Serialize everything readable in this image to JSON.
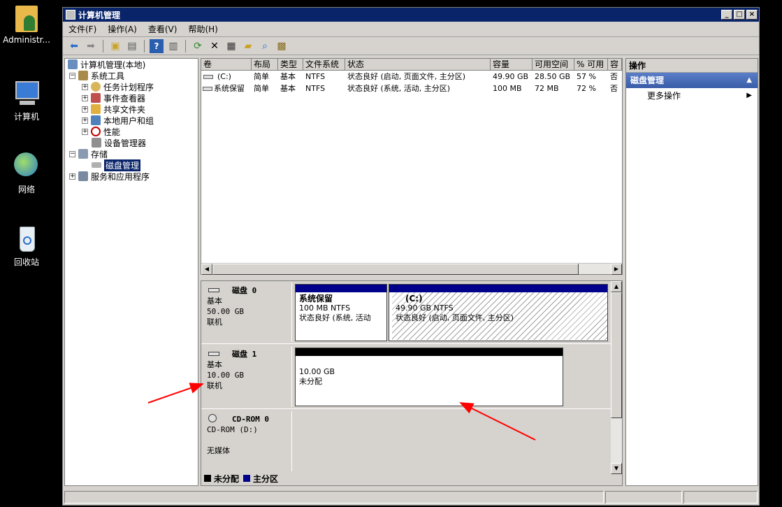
{
  "desktop": {
    "icons": [
      {
        "label": "Administr..."
      },
      {
        "label": "计算机"
      },
      {
        "label": "网络"
      },
      {
        "label": "回收站"
      }
    ]
  },
  "window": {
    "title": "计算机管理",
    "controls": {
      "minimize": "_",
      "maximize": "□",
      "close": "×"
    }
  },
  "menu": [
    "文件(F)",
    "操作(A)",
    "查看(V)",
    "帮助(H)"
  ],
  "tree": {
    "root": "计算机管理(本地)",
    "system_tools": "系统工具",
    "task_scheduler": "任务计划程序",
    "event_viewer": "事件查看器",
    "shared_folders": "共享文件夹",
    "local_users": "本地用户和组",
    "performance": "性能",
    "device_manager": "设备管理器",
    "storage": "存储",
    "disk_management": "磁盘管理",
    "services": "服务和应用程序"
  },
  "volumes": {
    "headers": [
      "卷",
      "布局",
      "类型",
      "文件系统",
      "状态",
      "容量",
      "可用空间",
      "% 可用",
      "容"
    ],
    "rows": [
      [
        "(C:)",
        "简单",
        "基本",
        "NTFS",
        "状态良好 (启动, 页面文件, 主分区)",
        "49.90 GB",
        "28.50 GB",
        "57 %",
        "否"
      ],
      [
        "系统保留",
        "简单",
        "基本",
        "NTFS",
        "状态良好 (系统, 活动, 主分区)",
        "100 MB",
        "72 MB",
        "72 %",
        "否"
      ]
    ]
  },
  "disks": {
    "disk0": {
      "name": "磁盘 0",
      "type": "基本",
      "size": "50.00 GB",
      "status": "联机",
      "p1": {
        "name": "系统保留",
        "size": "100 MB NTFS",
        "status": "状态良好 (系统, 活动"
      },
      "p2": {
        "name": "(C:)",
        "size": "49.90 GB NTFS",
        "status": "状态良好 (启动, 页面文件, 主分区)"
      }
    },
    "disk1": {
      "name": "磁盘 1",
      "type": "基本",
      "size": "10.00 GB",
      "status": "联机",
      "p1": {
        "size": "10.00 GB",
        "status": "未分配"
      }
    },
    "cdrom": {
      "name": "CD-ROM 0",
      "drive": "CD-ROM (D:)",
      "status": "无媒体"
    }
  },
  "legend": {
    "unallocated": "未分配",
    "primary": "主分区"
  },
  "actions": {
    "header": "操作",
    "section": "磁盘管理",
    "more": "更多操作"
  },
  "colors": {
    "primary": "#00008b",
    "unallocated": "#000000",
    "titlebar": "#0a246a",
    "annotation": "#ff0000"
  }
}
